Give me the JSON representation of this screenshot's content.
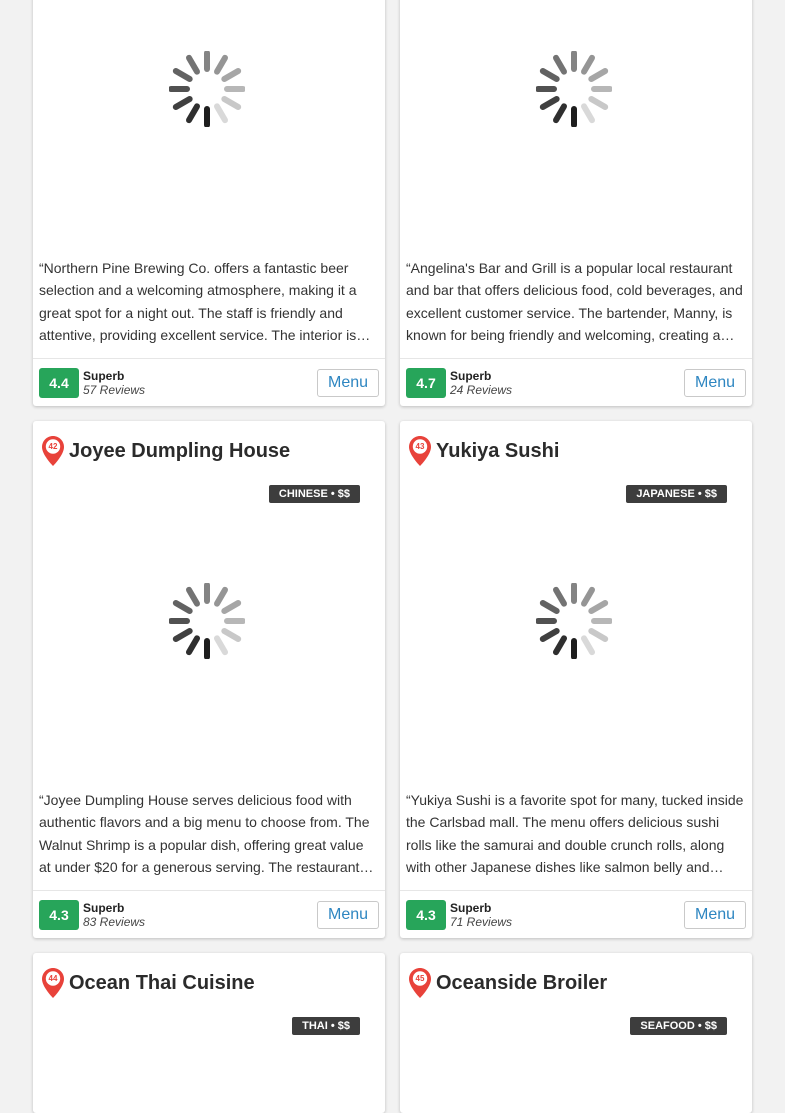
{
  "cards": [
    {
      "description": "“Northern Pine Brewing Co. offers a fantastic beer selection and a welcoming atmosphere, making it a great spot for a night out. The staff is friendly and attentive, providing excellent service. The interior is…",
      "score": "4.4",
      "label": "Superb",
      "reviews": "57 Reviews",
      "menu": "Menu"
    },
    {
      "description": "“Angelina's Bar and Grill is a popular local restaurant and bar that offers delicious food, cold beverages, and excellent customer service. The bartender, Manny, is known for being friendly and welcoming, creating a…",
      "score": "4.7",
      "label": "Superb",
      "reviews": "24 Reviews",
      "menu": "Menu"
    },
    {
      "number": "42",
      "name": "Joyee Dumpling House",
      "tag": "CHINESE • $$",
      "description": "“Joyee Dumpling House serves delicious food with authentic flavors and a big menu to choose from. The Walnut Shrimp is a popular dish, offering great value at under $20 for a generous serving. The restaurant…",
      "score": "4.3",
      "label": "Superb",
      "reviews": "83 Reviews",
      "menu": "Menu"
    },
    {
      "number": "43",
      "name": "Yukiya Sushi",
      "tag": "JAPANESE • $$",
      "description": "“Yukiya Sushi is a favorite spot for many, tucked inside the Carlsbad mall. The menu offers delicious sushi rolls like the samurai and double crunch rolls, along with other Japanese dishes like salmon belly and…",
      "score": "4.3",
      "label": "Superb",
      "reviews": "71 Reviews",
      "menu": "Menu"
    },
    {
      "number": "44",
      "name": "Ocean Thai Cuisine",
      "tag": "THAI • $$"
    },
    {
      "number": "45",
      "name": "Oceanside Broiler",
      "tag": "SEAFOOD • $$"
    }
  ],
  "colors": {
    "accent": "#e8423a",
    "score": "#27a55a",
    "tag": "#3d3d3d",
    "link": "#2e86c1"
  },
  "icons": {
    "pin": "map-pin-icon",
    "loading": "loading-spinner-icon"
  }
}
